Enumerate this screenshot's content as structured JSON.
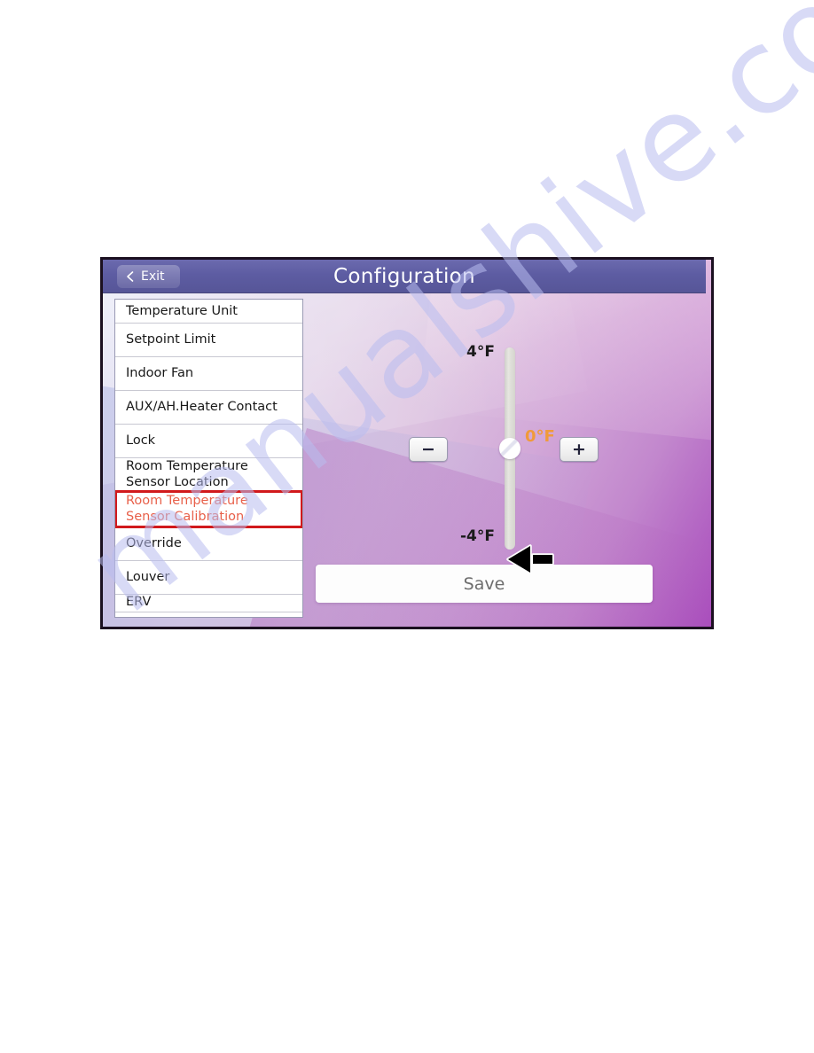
{
  "page": {
    "watermark": "manualshive.com"
  },
  "device": {
    "header": {
      "title": "Configuration",
      "exit_label": "Exit",
      "back_icon": "chevron-left-icon"
    },
    "settings_list": [
      {
        "id": "temperature-unit",
        "line1": "Temperature Unit",
        "line2": "",
        "state": "clipped-top"
      },
      {
        "id": "setpoint-limit",
        "line1": "Setpoint Limit",
        "line2": "",
        "state": "normal"
      },
      {
        "id": "indoor-fan",
        "line1": "Indoor Fan",
        "line2": "",
        "state": "normal"
      },
      {
        "id": "aux-ah-heater-contact",
        "line1": "AUX/AH.Heater Contact",
        "line2": "",
        "state": "normal"
      },
      {
        "id": "lock",
        "line1": "Lock",
        "line2": "",
        "state": "normal"
      },
      {
        "id": "room-temperature-sensor-location",
        "line1": "Room Temperature",
        "line2": "Sensor Location",
        "state": "normal"
      },
      {
        "id": "room-temperature-sensor-calibration",
        "line1": "Room Temperature",
        "line2": "Sensor Calibration",
        "state": "highlighted"
      },
      {
        "id": "override",
        "line1": "Override",
        "line2": "",
        "state": "normal"
      },
      {
        "id": "louver",
        "line1": "Louver",
        "line2": "",
        "state": "normal"
      },
      {
        "id": "erv",
        "line1": "ERV",
        "line2": "",
        "state": "clipped-bottom"
      }
    ],
    "calibration_control": {
      "max_label": "4°F",
      "min_label": "-4°F",
      "current_value": "0°F",
      "decrement_glyph": "−",
      "increment_glyph": "+",
      "decrement_icon": "minus-icon",
      "increment_icon": "plus-icon",
      "slider_icon": "vertical-slider"
    },
    "save_label": "Save"
  },
  "annotation": {
    "arrow_icon": "left-pointing-arrow",
    "highlight_color": "#d1191c",
    "highlight_text_color": "#e8604a",
    "accent_color": "#f09a3a"
  }
}
